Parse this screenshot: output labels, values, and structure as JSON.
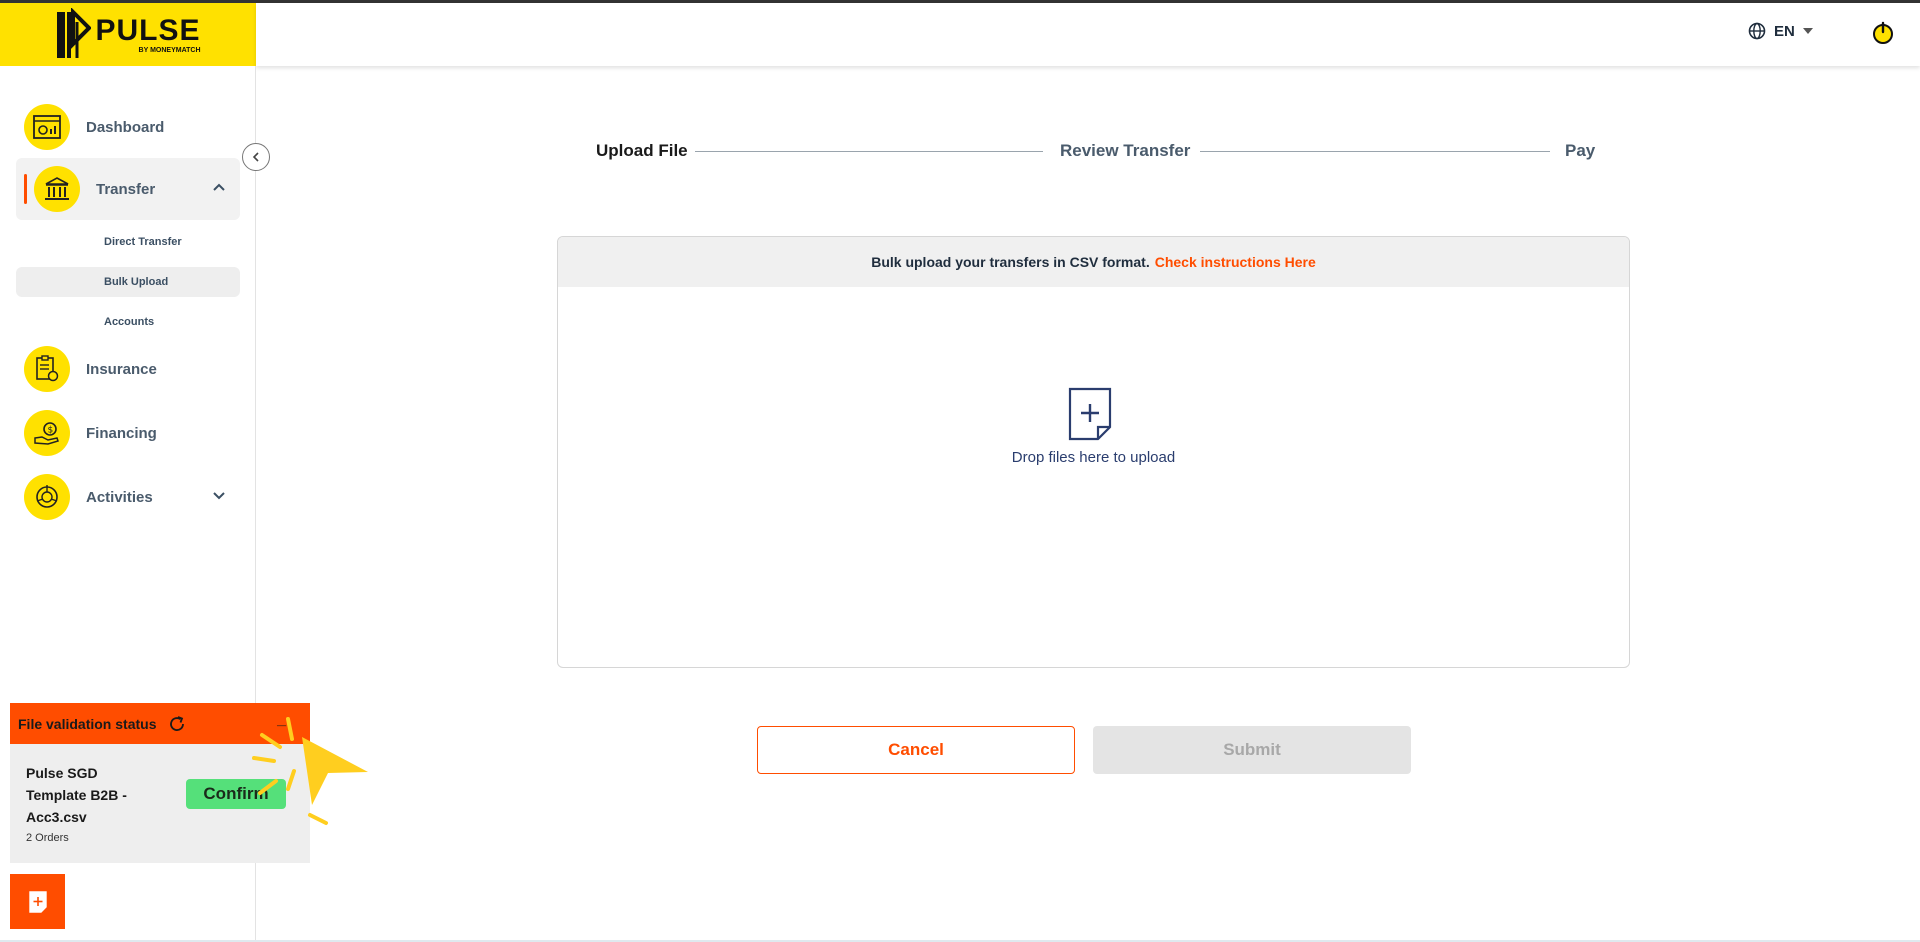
{
  "brand": {
    "logo_text": "PULSE",
    "logo_subtext": "BY MONEYMATCH",
    "accent_color": "#ffe100",
    "action_color": "#ff4d00"
  },
  "header": {
    "language": "EN",
    "language_icon": "globe-icon",
    "power_icon": "power-icon"
  },
  "sidebar": {
    "items": [
      {
        "label": "Dashboard",
        "icon": "dashboard-icon"
      },
      {
        "label": "Transfer",
        "icon": "bank-transfer-icon",
        "expanded": true
      },
      {
        "label": "Insurance",
        "icon": "insurance-icon"
      },
      {
        "label": "Financing",
        "icon": "financing-icon"
      },
      {
        "label": "Activities",
        "icon": "activities-icon"
      }
    ],
    "transfer_sub": [
      "Direct Transfer",
      "Bulk Upload",
      "Accounts"
    ],
    "active_sub": "Bulk Upload"
  },
  "stepper": {
    "steps": [
      "Upload File",
      "Review Transfer",
      "Pay"
    ],
    "current": "Upload File"
  },
  "upload": {
    "instruction": "Bulk upload your transfers in CSV format.",
    "instruction_link": "Check instructions Here",
    "drop_text": "Drop files here to upload"
  },
  "buttons": {
    "cancel": "Cancel",
    "submit": "Submit"
  },
  "validation": {
    "title": "File validation status",
    "minimize": "_",
    "file_name": "Pulse SGD Template B2B - Acc3.csv",
    "orders": "2 Orders",
    "confirm": "Confirm"
  }
}
